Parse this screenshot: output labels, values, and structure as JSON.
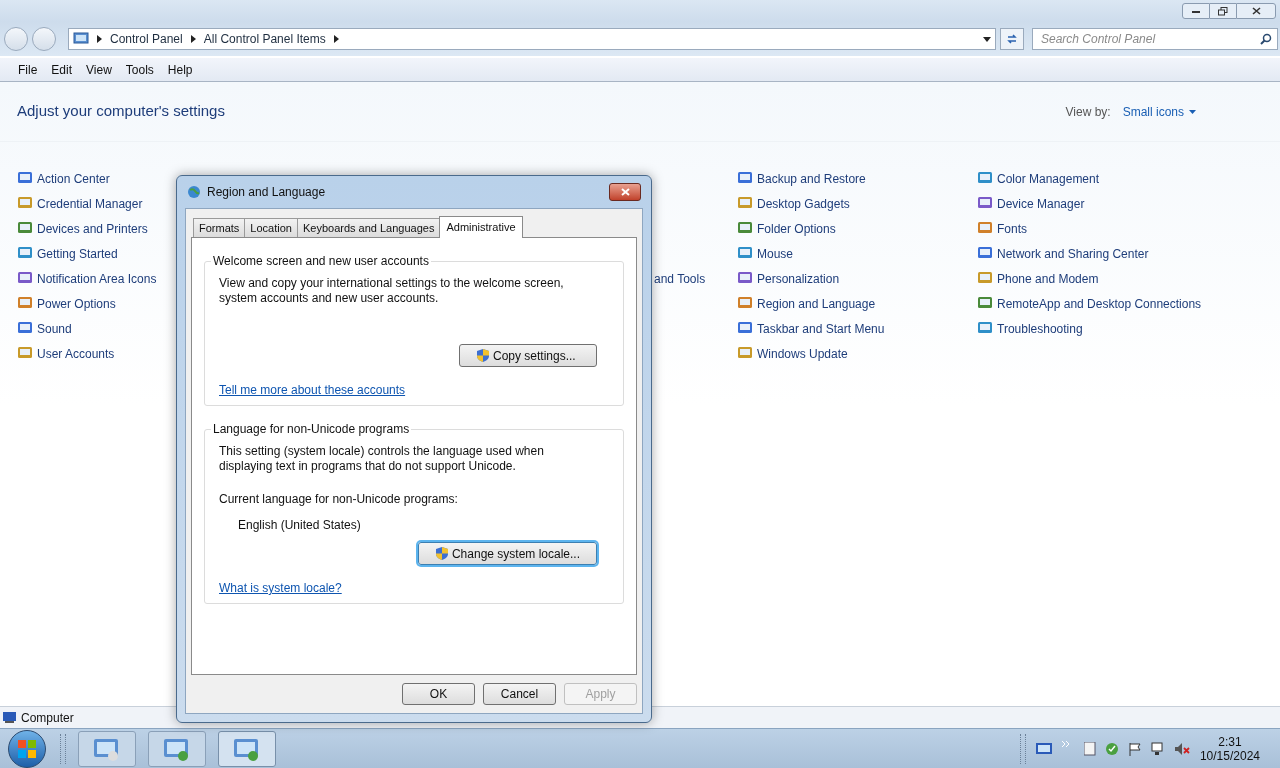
{
  "window": {
    "breadcrumbs": [
      "Control Panel",
      "All Control Panel Items"
    ],
    "search": {
      "placeholder": "Search Control Panel"
    },
    "menu": [
      "File",
      "Edit",
      "View",
      "Tools",
      "Help"
    ]
  },
  "header": {
    "title": "Adjust your computer's settings",
    "view_by_label": "View by:",
    "view_by_value": "Small icons"
  },
  "columns": [
    {
      "items": [
        {
          "label": "Action Center"
        },
        {
          "label": "Credential Manager"
        },
        {
          "label": "Devices and Printers"
        },
        {
          "label": "Getting Started"
        },
        {
          "label": "Notification Area Icons"
        },
        {
          "label": "Power Options"
        },
        {
          "label": "Sound"
        },
        {
          "label": "User Accounts"
        }
      ]
    },
    {
      "items": [
        {
          "kind": "clipped",
          "label": "and Tools"
        }
      ]
    },
    {
      "items": [
        {
          "label": "Backup and Restore"
        },
        {
          "label": "Desktop Gadgets"
        },
        {
          "label": "Folder Options"
        },
        {
          "label": "Mouse"
        },
        {
          "label": "Personalization"
        },
        {
          "label": "Region and Language"
        },
        {
          "label": "Taskbar and Start Menu"
        },
        {
          "label": "Windows Update"
        }
      ]
    },
    {
      "items": [
        {
          "label": "Color Management"
        },
        {
          "label": "Device Manager"
        },
        {
          "label": "Fonts"
        },
        {
          "label": "Network and Sharing Center"
        },
        {
          "label": "Phone and Modem"
        },
        {
          "label": "RemoteApp and Desktop Connections"
        },
        {
          "label": "Troubleshooting"
        }
      ]
    }
  ],
  "status_bar": {
    "text": "Computer"
  },
  "dialog": {
    "title": "Region and Language",
    "tabs": [
      {
        "label": "Formats",
        "selected": false
      },
      {
        "label": "Location",
        "selected": false
      },
      {
        "label": "Keyboards and Languages",
        "selected": false
      },
      {
        "label": "Administrative",
        "selected": true
      }
    ],
    "groups": [
      {
        "title": "Welcome screen and new user accounts",
        "text": "View and copy your international settings to the welcome screen, system accounts and new user accounts.",
        "button": {
          "label": "Copy settings...",
          "focused": false
        },
        "link": "Tell me more about these accounts"
      },
      {
        "title": "Language for non-Unicode programs",
        "text": "This setting (system locale) controls the language used when displaying text in programs that do not support Unicode.",
        "current_label": "Current language for non-Unicode programs:",
        "current_value": "English (United States)",
        "button": {
          "label": "Change system locale...",
          "focused": true
        },
        "link": "What is system locale?"
      }
    ],
    "buttons": [
      {
        "label": "OK",
        "disabled": false
      },
      {
        "label": "Cancel",
        "disabled": false
      },
      {
        "label": "Apply",
        "disabled": true
      }
    ]
  },
  "taskbar": {
    "clock": {
      "time": "2:31",
      "date": "10/15/2024"
    }
  }
}
